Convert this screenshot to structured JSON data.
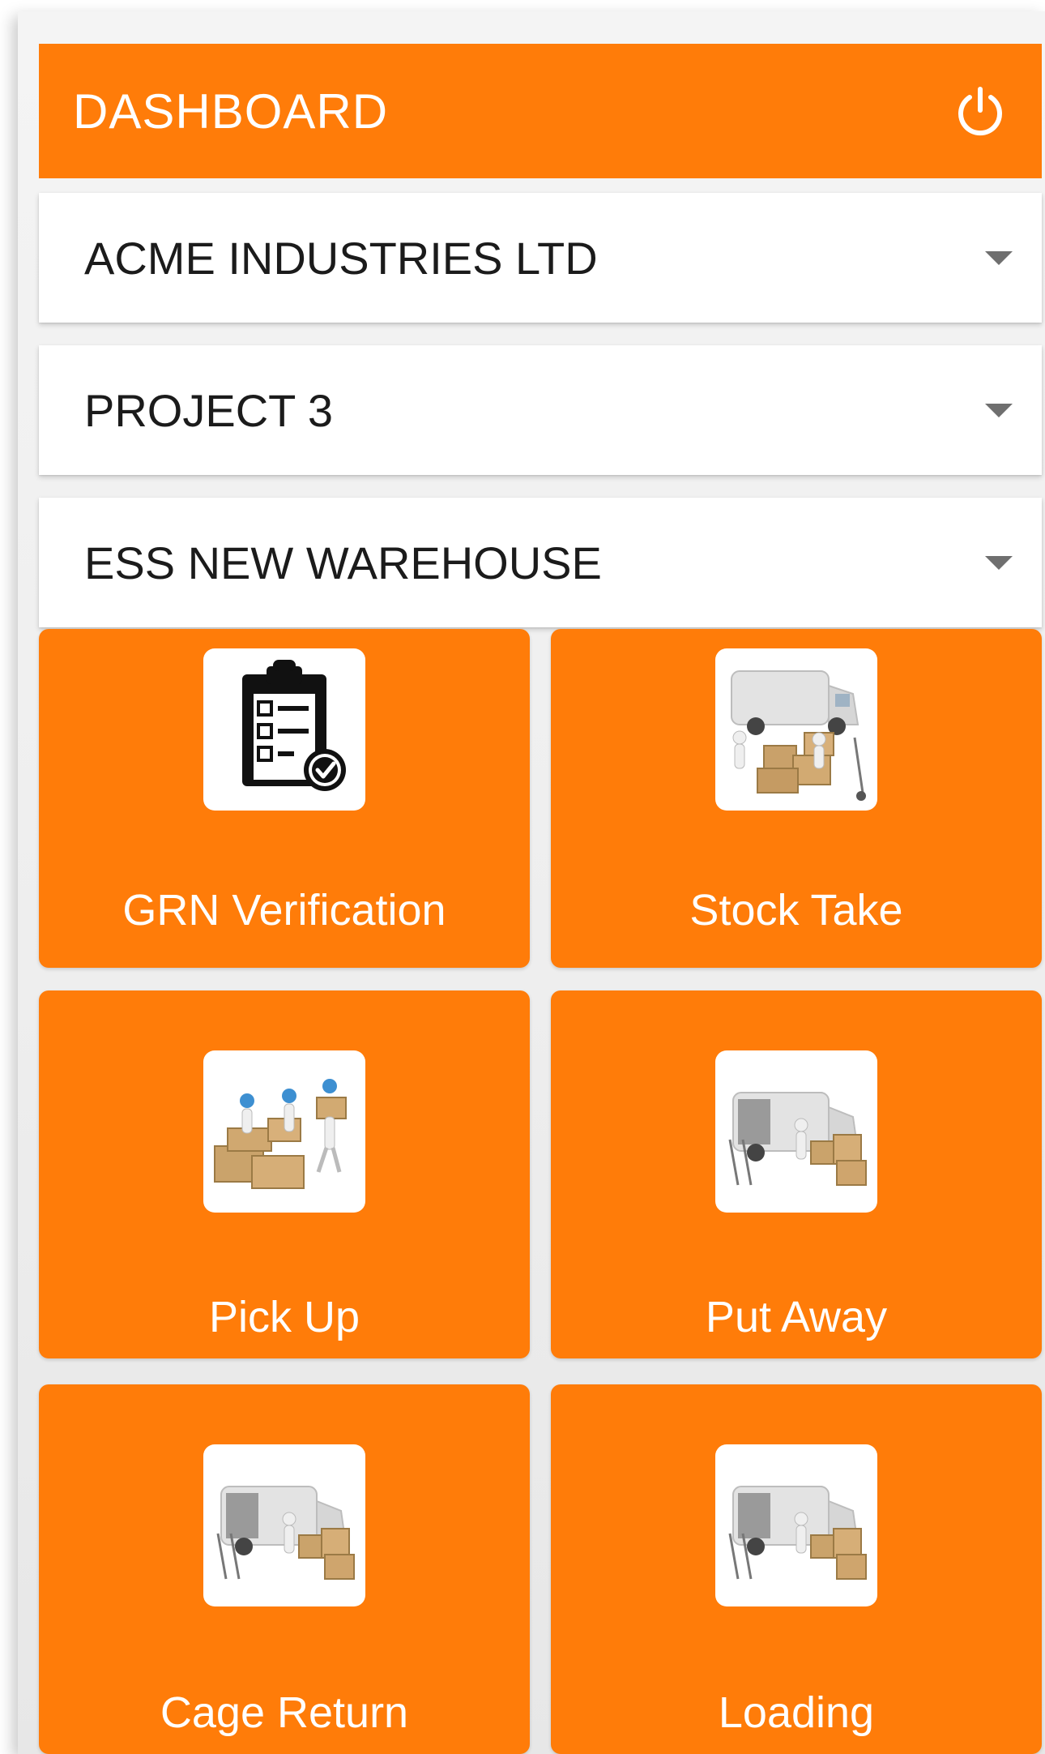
{
  "header": {
    "title": "DASHBOARD",
    "power_icon": "power-icon"
  },
  "selectors": {
    "company": "ACME INDUSTRIES LTD",
    "project": "PROJECT 3",
    "warehouse": "ESS NEW WAREHOUSE"
  },
  "tiles": [
    {
      "label": "GRN Verification",
      "icon": "checklist-icon"
    },
    {
      "label": "Stock Take",
      "icon": "van-boxes-icon"
    },
    {
      "label": "Pick Up",
      "icon": "workers-boxes-icon"
    },
    {
      "label": "Put Away",
      "icon": "van-boxes-icon"
    },
    {
      "label": "Cage Return",
      "icon": "van-boxes-icon"
    },
    {
      "label": "Loading",
      "icon": "van-boxes-icon"
    }
  ],
  "colors": {
    "accent": "#ff7c09",
    "card": "#ffffff",
    "text_dark": "#1b1b1b"
  }
}
